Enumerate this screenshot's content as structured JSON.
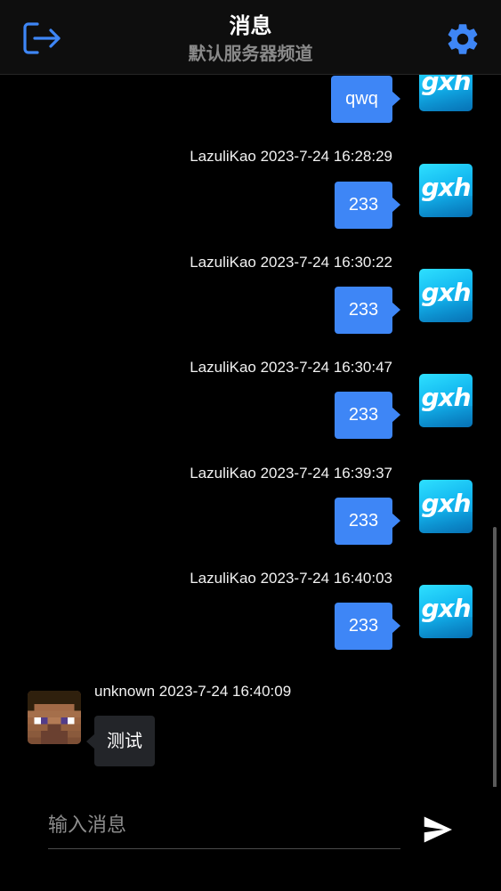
{
  "header": {
    "title": "消息",
    "subtitle": "默认服务器频道",
    "accent_color": "#3e86f6",
    "left_icon": "logout-icon",
    "right_icon": "gear-icon"
  },
  "messages": [
    {
      "direction": "out",
      "meta": "",
      "text": "qwq",
      "avatar_text": "gxh"
    },
    {
      "direction": "out",
      "meta": "LazuliKao 2023-7-24 16:28:29",
      "text": "233",
      "avatar_text": "gxh"
    },
    {
      "direction": "out",
      "meta": "LazuliKao 2023-7-24 16:30:22",
      "text": "233",
      "avatar_text": "gxh"
    },
    {
      "direction": "out",
      "meta": "LazuliKao 2023-7-24 16:30:47",
      "text": "233",
      "avatar_text": "gxh"
    },
    {
      "direction": "out",
      "meta": "LazuliKao 2023-7-24 16:39:37",
      "text": "233",
      "avatar_text": "gxh"
    },
    {
      "direction": "out",
      "meta": "LazuliKao 2023-7-24 16:40:03",
      "text": "233",
      "avatar_text": "gxh"
    },
    {
      "direction": "in",
      "meta": "unknown 2023-7-24 16:40:09",
      "text": "测试",
      "avatar_icon": "steve-avatar-icon"
    }
  ],
  "composer": {
    "placeholder": "输入消息",
    "value": "",
    "send_icon": "send-icon"
  }
}
